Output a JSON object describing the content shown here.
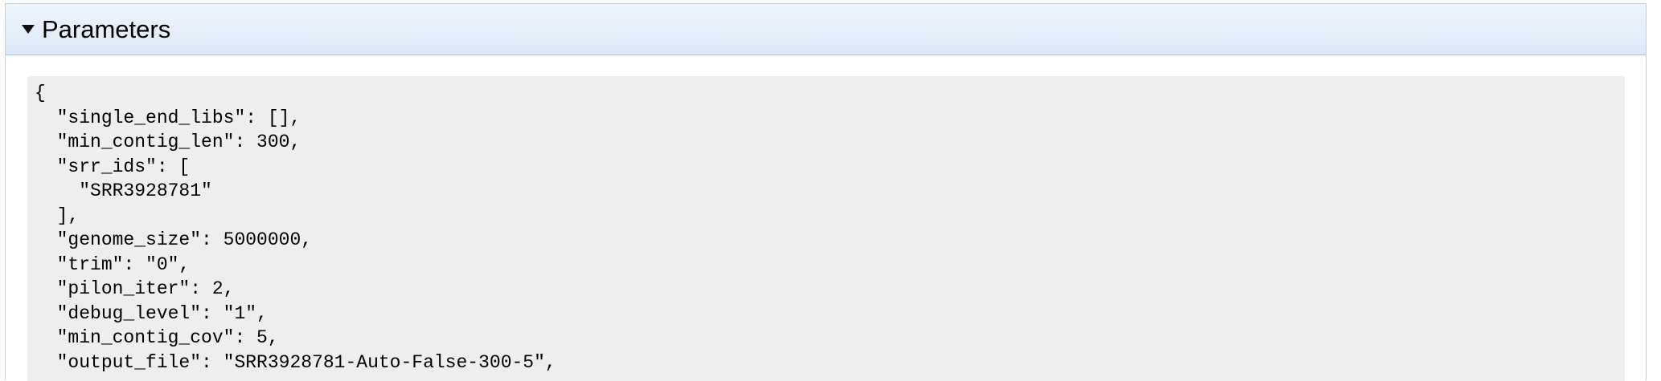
{
  "panel": {
    "title": "Parameters",
    "toggle_icon": "triangle-down-icon"
  },
  "code": {
    "lines": [
      "{",
      "  \"single_end_libs\": [],",
      "  \"min_contig_len\": 300,",
      "  \"srr_ids\": [",
      "    \"SRR3928781\"",
      "  ],",
      "  \"genome_size\": 5000000,",
      "  \"trim\": \"0\",",
      "  \"pilon_iter\": 2,",
      "  \"debug_level\": \"1\",",
      "  \"min_contig_cov\": 5,",
      "  \"output_file\": \"SRR3928781-Auto-False-300-5\","
    ]
  }
}
